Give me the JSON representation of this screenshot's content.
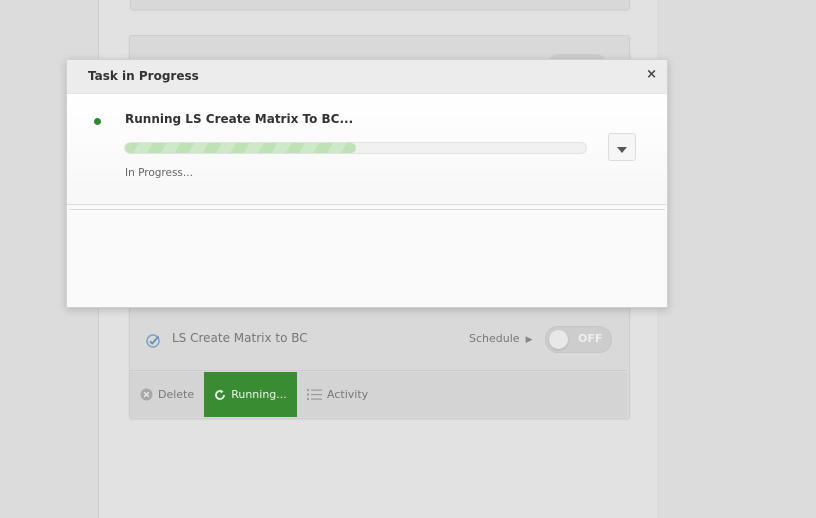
{
  "background_card": {
    "task_name": "LS Create Matrix to BC",
    "schedule_label": "Schedule",
    "toggle_label": "OFF",
    "actions": {
      "delete_label": "Delete",
      "running_label": "Running...",
      "activity_label": "Activity"
    }
  },
  "modal": {
    "title": "Task in Progress",
    "close_label": "×",
    "task": {
      "title": "Running LS Create Matrix To BC...",
      "status_text": "In Progress...",
      "progress_percent": 50
    }
  },
  "colors": {
    "running_button": "#3a8c32",
    "status_dot": "#2c8a2c",
    "progress_fill": "#bfe1b6"
  },
  "icons": {
    "close": "close-icon",
    "expand": "chevron-down-icon",
    "check": "check-circle-icon",
    "delete": "x-circle-icon",
    "running": "refresh-icon",
    "activity": "list-icon",
    "schedule_arrow": "play-arrow-icon"
  }
}
